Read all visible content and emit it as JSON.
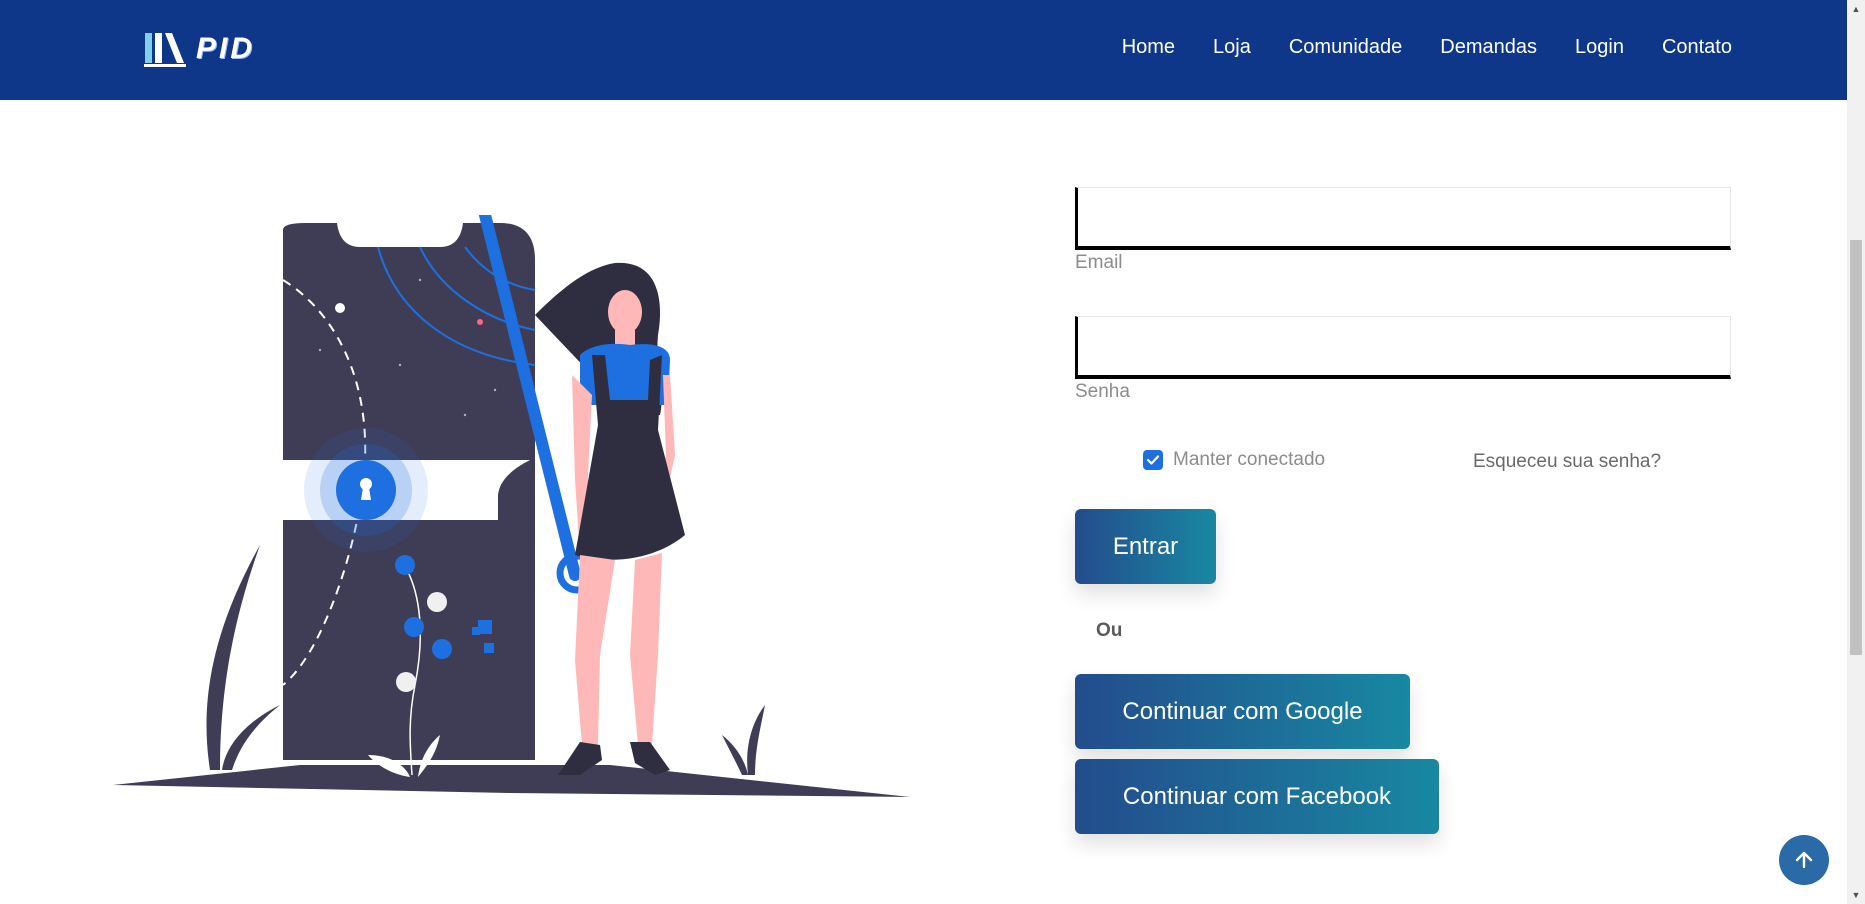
{
  "header": {
    "logo_text": "PID",
    "nav": [
      {
        "label": "Home"
      },
      {
        "label": "Loja"
      },
      {
        "label": "Comunidade"
      },
      {
        "label": "Demandas"
      },
      {
        "label": "Login"
      },
      {
        "label": "Contato"
      }
    ]
  },
  "login": {
    "email_label": "Email",
    "email_value": "",
    "password_label": "Senha",
    "password_value": "",
    "remember_label": "Manter conectado",
    "remember_checked": true,
    "forgot_label": "Esqueceu sua senha?",
    "submit_label": "Entrar",
    "or_label": "Ou",
    "google_label": "Continuar com Google",
    "facebook_label": "Continuar com Facebook"
  },
  "icons": {
    "back_to_top": "arrow-up-icon",
    "checkbox": "check-icon",
    "logo": "books-logo-icon"
  },
  "colors": {
    "header_bg": "#0f3789",
    "button_gradient_start": "#234c8c",
    "button_gradient_end": "#1888a2",
    "accent_blue": "#1e6fe0",
    "illustration_dark": "#3f3d56",
    "back_to_top_bg": "#2a6aa6"
  }
}
